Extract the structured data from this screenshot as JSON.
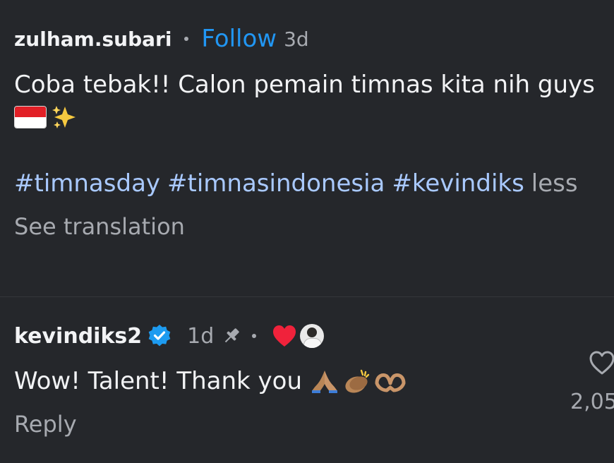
{
  "post": {
    "username": "zulham.subari",
    "follow_label": "Follow",
    "time": "3d",
    "caption": "Coba tebak!! Calon pemain timnas kita nih guys",
    "hashtags": [
      "#timnasday",
      "#timnasindonesia",
      "#kevindiks"
    ],
    "less_label": "less",
    "see_translation": "See translation"
  },
  "comment": {
    "username": "kevindiks2",
    "time": "1d",
    "text": "Wow! Talent! Thank you",
    "reply_label": "Reply",
    "like_count": "2,05"
  },
  "colors": {
    "background": "#25272b",
    "follow": "#2196f3",
    "hashtag": "#a9c9ff",
    "muted": "#a7aab0",
    "verified": "#1d9bf0",
    "heart": "#f0223b"
  },
  "icons": {
    "flag": "indonesia-flag-icon",
    "sparkles": "sparkles-icon",
    "verified": "verified-badge-icon",
    "pin": "pin-icon",
    "creator_like": "red-heart-icon",
    "like": "heart-outline-icon"
  }
}
